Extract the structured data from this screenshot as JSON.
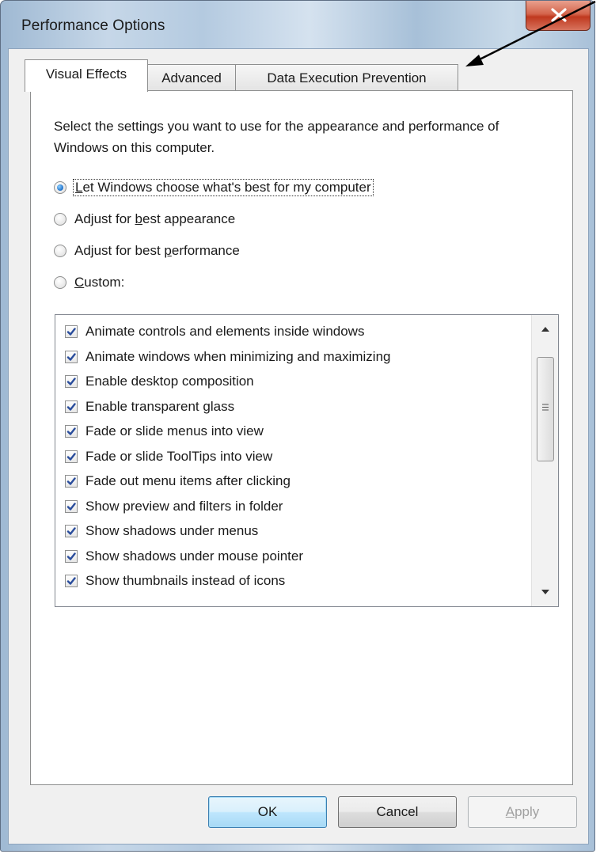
{
  "window": {
    "title": "Performance Options"
  },
  "tabs": [
    {
      "label": "Visual Effects",
      "active": true
    },
    {
      "label": "Advanced",
      "active": false
    },
    {
      "label": "Data Execution Prevention",
      "active": false
    }
  ],
  "visual_effects": {
    "description": "Select the settings you want to use for the appearance and performance of Windows on this computer.",
    "options": [
      {
        "pre": "",
        "key": "L",
        "post": "et Windows choose what's best for my computer",
        "checked": true
      },
      {
        "pre": "Adjust for ",
        "key": "b",
        "post": "est appearance",
        "checked": false
      },
      {
        "pre": "Adjust for best ",
        "key": "p",
        "post": "erformance",
        "checked": false
      },
      {
        "pre": "",
        "key": "C",
        "post": "ustom:",
        "checked": false
      }
    ],
    "effects": [
      {
        "label": "Animate controls and elements inside windows",
        "checked": true
      },
      {
        "label": "Animate windows when minimizing and maximizing",
        "checked": true
      },
      {
        "label": "Enable desktop composition",
        "checked": true
      },
      {
        "label": "Enable transparent glass",
        "checked": true
      },
      {
        "label": "Fade or slide menus into view",
        "checked": true
      },
      {
        "label": "Fade or slide ToolTips into view",
        "checked": true
      },
      {
        "label": "Fade out menu items after clicking",
        "checked": true
      },
      {
        "label": "Show preview and filters in folder",
        "checked": true
      },
      {
        "label": "Show shadows under menus",
        "checked": true
      },
      {
        "label": "Show shadows under mouse pointer",
        "checked": true
      },
      {
        "label": "Show thumbnails instead of icons",
        "checked": true
      }
    ]
  },
  "buttons": {
    "ok": "OK",
    "cancel": "Cancel",
    "apply_key": "A",
    "apply_rest": "pply"
  },
  "icons": {
    "close": "close-icon",
    "check": "check-icon",
    "scroll_up": "scroll-up-icon",
    "scroll_down": "scroll-down-icon",
    "grip": "grip-icon",
    "arrow": "annotation-arrow-icon"
  },
  "colors": {
    "accent": "#1c6fc8",
    "close_red": "#c0391f",
    "check_blue": "#2a4d9c"
  }
}
